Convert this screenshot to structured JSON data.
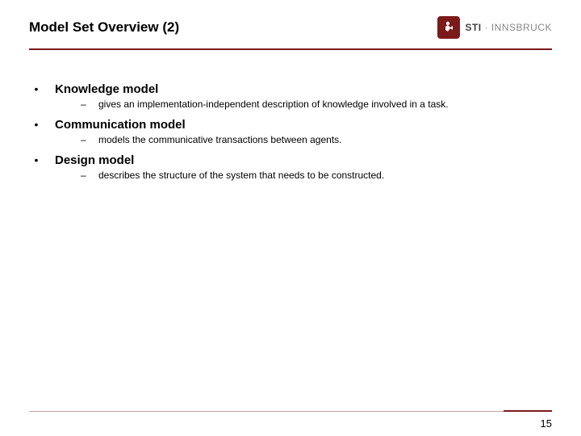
{
  "header": {
    "title": "Model Set Overview (2)",
    "logo": {
      "brand": "STI",
      "sep": " · ",
      "sub": "INNSBRUCK"
    }
  },
  "items": [
    {
      "label": "Knowledge  model",
      "sub": "gives an implementation-independent description of knowledge involved in a task."
    },
    {
      "label": "Communication model",
      "sub": "models the communicative transactions between agents."
    },
    {
      "label": "Design model",
      "sub": "describes the structure of the system that needs to be constructed."
    }
  ],
  "page_number": "15"
}
